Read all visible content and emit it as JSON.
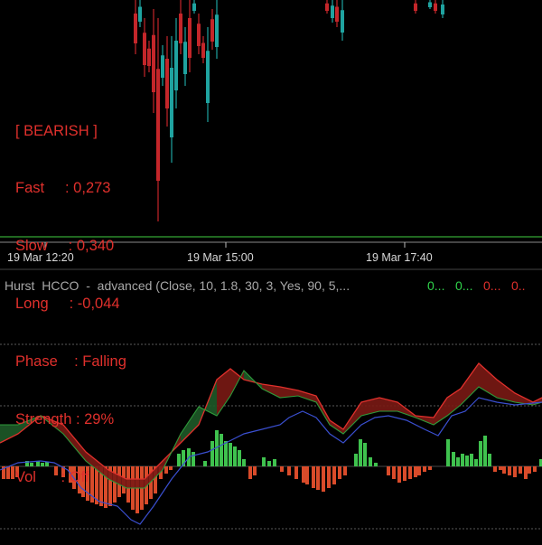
{
  "status_panel": {
    "title": "[ BEARISH ]",
    "rows": [
      "Fast     : 0,273",
      "Slow     : 0,340",
      "Long     : -0,044",
      "Phase    : Falling",
      "Strength : 29%",
      "Vol      : Off"
    ]
  },
  "time_axis": {
    "labels": [
      "19 Mar 12:20",
      "19 Mar 15:00",
      "19 Mar 17:40"
    ]
  },
  "indicator": {
    "title": "Hurst  HCCO  -  advanced (Close, 10, 1.8, 30, 3, Yes, 90, 5,...",
    "values": [
      {
        "text": "0...",
        "color": "#2fd24a"
      },
      {
        "text": "0...",
        "color": "#2fd24a"
      },
      {
        "text": "0...",
        "color": "#e0302c"
      },
      {
        "text": "0..",
        "color": "#e0302c"
      }
    ]
  },
  "colors": {
    "bull": "#1fa3a0",
    "bear": "#c4262a",
    "histogram_up": "#3fc24e",
    "histogram_down": "#d94b2a",
    "fast_line": "#3a4fd0",
    "band_green": "#1e5a28",
    "band_red": "#7a1a14"
  }
}
